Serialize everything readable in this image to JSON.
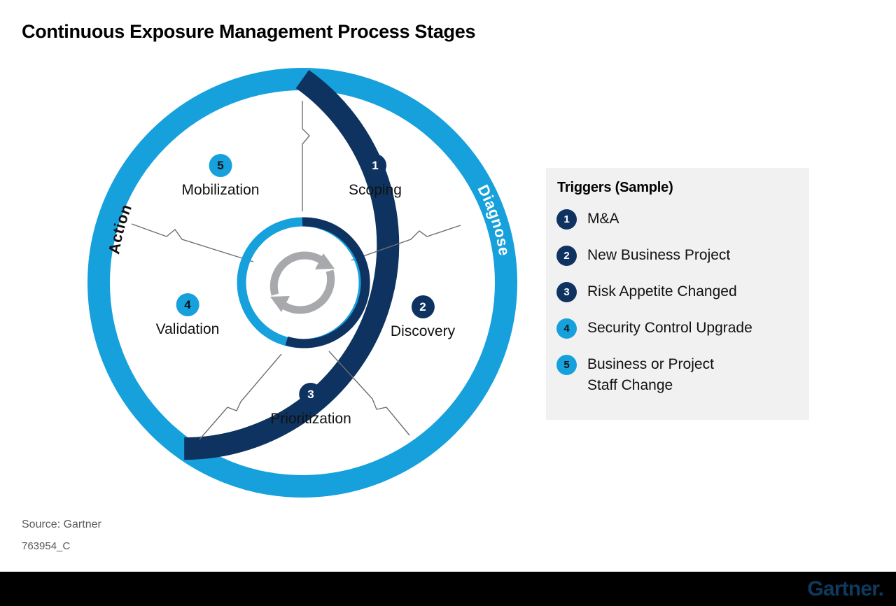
{
  "page": {
    "title": "Continuous Exposure Management Process Stages"
  },
  "colors": {
    "navy": "#0E3360",
    "light_blue": "#16A0DC",
    "panel_bg": "#f1f1f1",
    "connector": "#6d6e71",
    "center_icon": "#a7a9ac",
    "footer_bg": "#000000",
    "logo": "#10395e"
  },
  "diagram": {
    "arcs": [
      {
        "label": "Diagnose",
        "color": "#0E3360",
        "text_color": "#ffffff"
      },
      {
        "label": "Action",
        "color": "#16A0DC",
        "text_color": "#111111"
      }
    ],
    "center_icon": "refresh-cycle-icon",
    "stages": [
      {
        "number": "1",
        "label": "Scoping",
        "badge_color": "#0E3360",
        "number_color": "#ffffff"
      },
      {
        "number": "2",
        "label": "Discovery",
        "badge_color": "#0E3360",
        "number_color": "#ffffff"
      },
      {
        "number": "3",
        "label": "Prioritization",
        "badge_color": "#0E3360",
        "number_color": "#ffffff"
      },
      {
        "number": "4",
        "label": "Validation",
        "badge_color": "#16A0DC",
        "number_color": "#111111"
      },
      {
        "number": "5",
        "label": "Mobilization",
        "badge_color": "#16A0DC",
        "number_color": "#111111"
      }
    ]
  },
  "legend": {
    "title": "Triggers (Sample)",
    "items": [
      {
        "number": "1",
        "text": "M&A",
        "badge_color": "#0E3360",
        "number_color": "#ffffff"
      },
      {
        "number": "2",
        "text": "New Business Project",
        "badge_color": "#0E3360",
        "number_color": "#ffffff"
      },
      {
        "number": "3",
        "text": "Risk Appetite Changed",
        "badge_color": "#0E3360",
        "number_color": "#ffffff"
      },
      {
        "number": "4",
        "text": "Security Control Upgrade",
        "badge_color": "#16A0DC",
        "number_color": "#111111"
      },
      {
        "number": "5",
        "text": "Business or Project\nStaff Change",
        "badge_color": "#16A0DC",
        "number_color": "#111111"
      }
    ]
  },
  "source": {
    "line": "Source: Gartner",
    "code": "763954_C"
  },
  "footer": {
    "logo_text": "Gartner."
  }
}
